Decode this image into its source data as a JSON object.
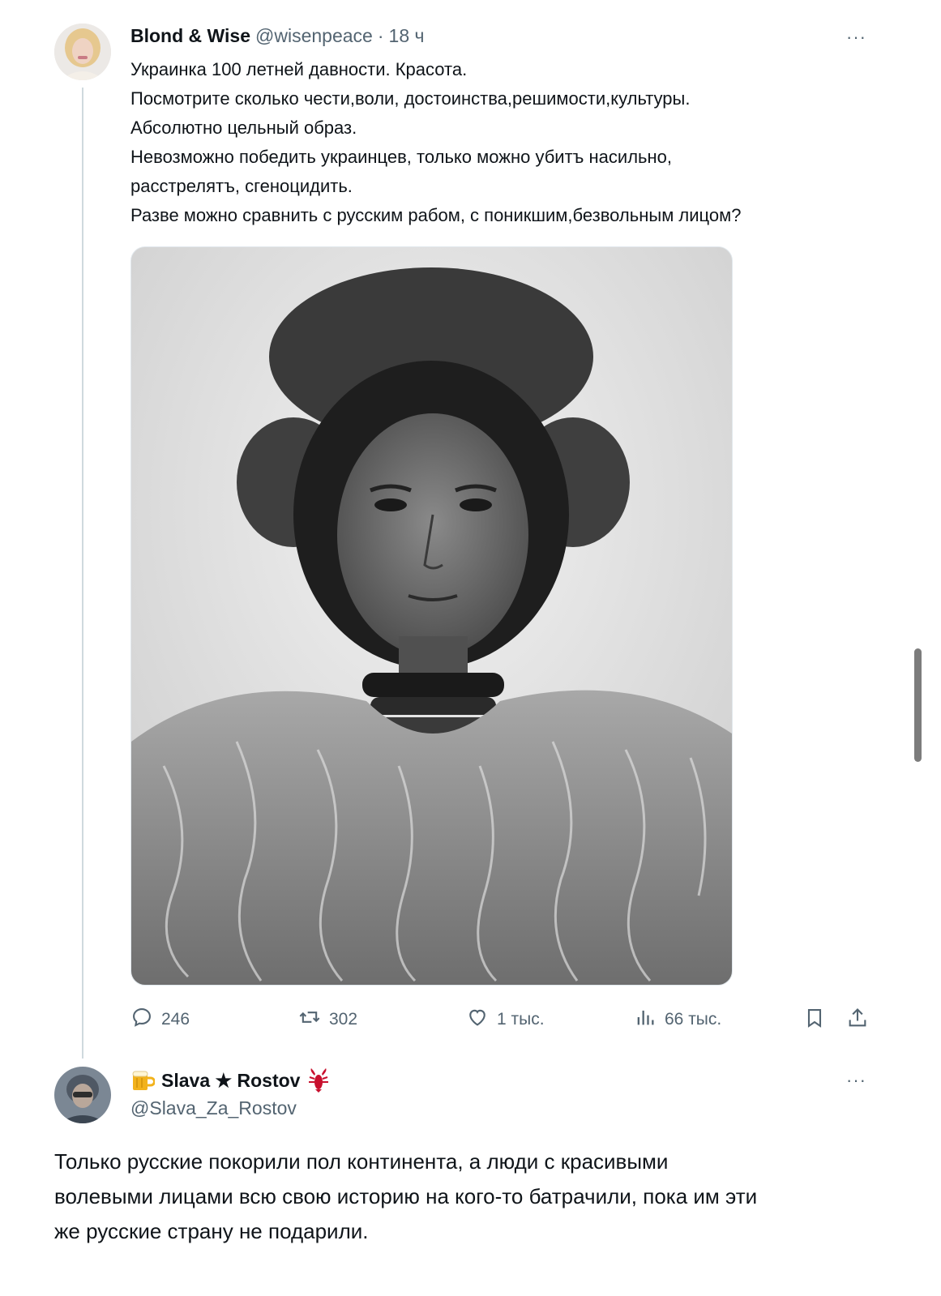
{
  "tweet": {
    "author_name": "Blond & Wise",
    "handle": "@wisenpeace",
    "separator": "·",
    "time": "18 ч",
    "more": "···",
    "lines": [
      "Украинка 100 летней давности. Красота.",
      "Посмотрите сколько чести,воли, достоинства,решимости,культуры.",
      "Абсолютно цельный образ.",
      "Невозможно победить украинцев, только можно убитъ насильно,",
      "расстрелятъ, сгеноцидить.",
      "Разве можно сравнить с русским рабом, с поникшим,безвольным лицом?"
    ],
    "actions": {
      "replies": "246",
      "retweets": "302",
      "likes": "1 тыс.",
      "views": "66 тыс."
    }
  },
  "reply": {
    "author_name": "Slava ★ Rostov",
    "handle": "@Slava_Za_Rostov",
    "more": "···",
    "lines": [
      "Только русские покорили пол континента, а люди с красивыми",
      "волевыми лицами всю свою историю на кого-то батрачили, пока им эти",
      "же русские страну не подарили."
    ]
  },
  "icons": {
    "reply": "comment-icon",
    "retweet": "retweet-icon",
    "like": "heart-icon",
    "views": "views-chart-icon",
    "bookmark": "bookmark-icon",
    "share": "share-icon",
    "badge_beer": "beer-mug-icon",
    "badge_crayfish": "crayfish-icon"
  },
  "colors": {
    "text": "#0f1419",
    "muted": "#536471",
    "thread_line": "#cfd9de",
    "crayfish": "#c8102e",
    "beer": "#f2b21b"
  }
}
